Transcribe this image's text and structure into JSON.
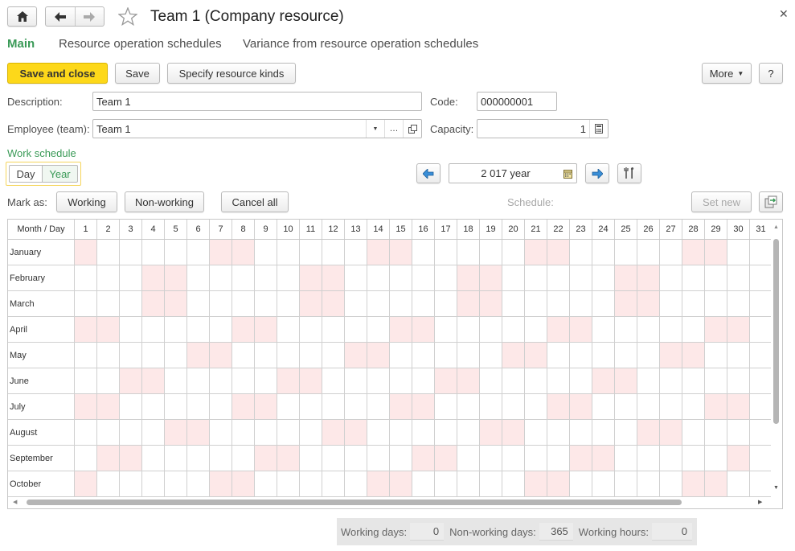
{
  "window": {
    "title": "Team 1 (Company resource)"
  },
  "tabs": [
    {
      "label": "Main",
      "active": true
    },
    {
      "label": "Resource operation schedules",
      "active": false
    },
    {
      "label": "Variance from resource operation schedules",
      "active": false
    }
  ],
  "toolbar": {
    "save_close_label": "Save and close",
    "save_label": "Save",
    "specify_kinds_label": "Specify resource kinds",
    "more_label": "More",
    "help_label": "?"
  },
  "form": {
    "description_label": "Description:",
    "description_value": "Team 1",
    "code_label": "Code:",
    "code_value": "000000001",
    "employee_label": "Employee (team):",
    "employee_value": "Team 1",
    "capacity_label": "Capacity:",
    "capacity_value": "1"
  },
  "schedule": {
    "section_label": "Work schedule",
    "view_day": "Day",
    "view_year": "Year",
    "period_value": "2 017 year",
    "mark_as_label": "Mark as:",
    "working_label": "Working",
    "nonworking_label": "Non-working",
    "cancel_all_label": "Cancel all",
    "schedule_label": "Schedule:",
    "set_new_label": "Set new"
  },
  "calendar": {
    "corner_header": "Month / Day",
    "days": [
      "1",
      "2",
      "3",
      "4",
      "5",
      "6",
      "7",
      "8",
      "9",
      "10",
      "11",
      "12",
      "13",
      "14",
      "15",
      "16",
      "17",
      "18",
      "19",
      "20",
      "21",
      "22",
      "23",
      "24",
      "25",
      "26",
      "27",
      "28",
      "29",
      "30",
      "31"
    ],
    "months": [
      {
        "name": "January",
        "offdays": [
          1,
          7,
          8,
          14,
          15,
          21,
          22,
          28,
          29
        ]
      },
      {
        "name": "February",
        "offdays": [
          4,
          5,
          11,
          12,
          18,
          19,
          25,
          26
        ]
      },
      {
        "name": "March",
        "offdays": [
          4,
          5,
          11,
          12,
          18,
          19,
          25,
          26
        ]
      },
      {
        "name": "April",
        "offdays": [
          1,
          2,
          8,
          9,
          15,
          16,
          22,
          23,
          29,
          30
        ]
      },
      {
        "name": "May",
        "offdays": [
          6,
          7,
          13,
          14,
          20,
          21,
          27,
          28
        ]
      },
      {
        "name": "June",
        "offdays": [
          3,
          4,
          10,
          11,
          17,
          18,
          24,
          25
        ]
      },
      {
        "name": "July",
        "offdays": [
          1,
          2,
          8,
          9,
          15,
          16,
          22,
          23,
          29,
          30
        ]
      },
      {
        "name": "August",
        "offdays": [
          5,
          6,
          12,
          13,
          19,
          20,
          26,
          27
        ]
      },
      {
        "name": "September",
        "offdays": [
          2,
          3,
          9,
          10,
          16,
          17,
          23,
          24,
          30
        ]
      },
      {
        "name": "October",
        "offdays": [
          1,
          7,
          8,
          14,
          15,
          21,
          22,
          28,
          29
        ]
      }
    ],
    "offday_color": "#fde8e8"
  },
  "summary": {
    "working_days_label": "Working days:",
    "working_days_value": "0",
    "nonworking_days_label": "Non-working days:",
    "nonworking_days_value": "365",
    "working_hours_label": "Working hours:",
    "working_hours_value": "0"
  },
  "colors": {
    "accent_green": "#3a9a57",
    "primary_yellow": "#fdd81a"
  }
}
